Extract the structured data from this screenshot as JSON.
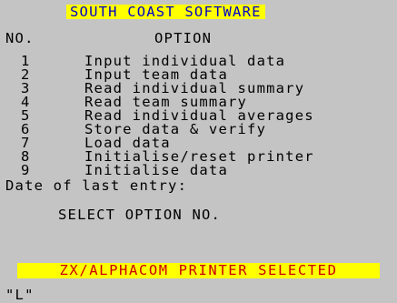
{
  "header": {
    "title": "SOUTH COAST SOFTWARE",
    "title_bg": "#ffff00",
    "title_color": "#0000cc"
  },
  "columns": {
    "number": "NO.",
    "option": "OPTION"
  },
  "menu": {
    "options": [
      {
        "number": "1",
        "label": "Input individual data"
      },
      {
        "number": "2",
        "label": "Input team data"
      },
      {
        "number": "3",
        "label": "Read individual summary"
      },
      {
        "number": "4",
        "label": "Read team summary"
      },
      {
        "number": "5",
        "label": "Read individual averages"
      },
      {
        "number": "6",
        "label": "Store data & verify"
      },
      {
        "number": "7",
        "label": "Load data"
      },
      {
        "number": "8",
        "label": "Initialise/reset printer"
      },
      {
        "number": "9",
        "label": "Initialise data"
      }
    ]
  },
  "status": {
    "date_label": "Date of last entry:",
    "prompt": "SELECT OPTION NO.",
    "printer": "ZX/ALPHACOM PRINTER SELECTED",
    "printer_bg": "#ffff00",
    "printer_color": "#cc0000",
    "input_line": "\"L\""
  },
  "screen_bg": "#c4c4c4"
}
